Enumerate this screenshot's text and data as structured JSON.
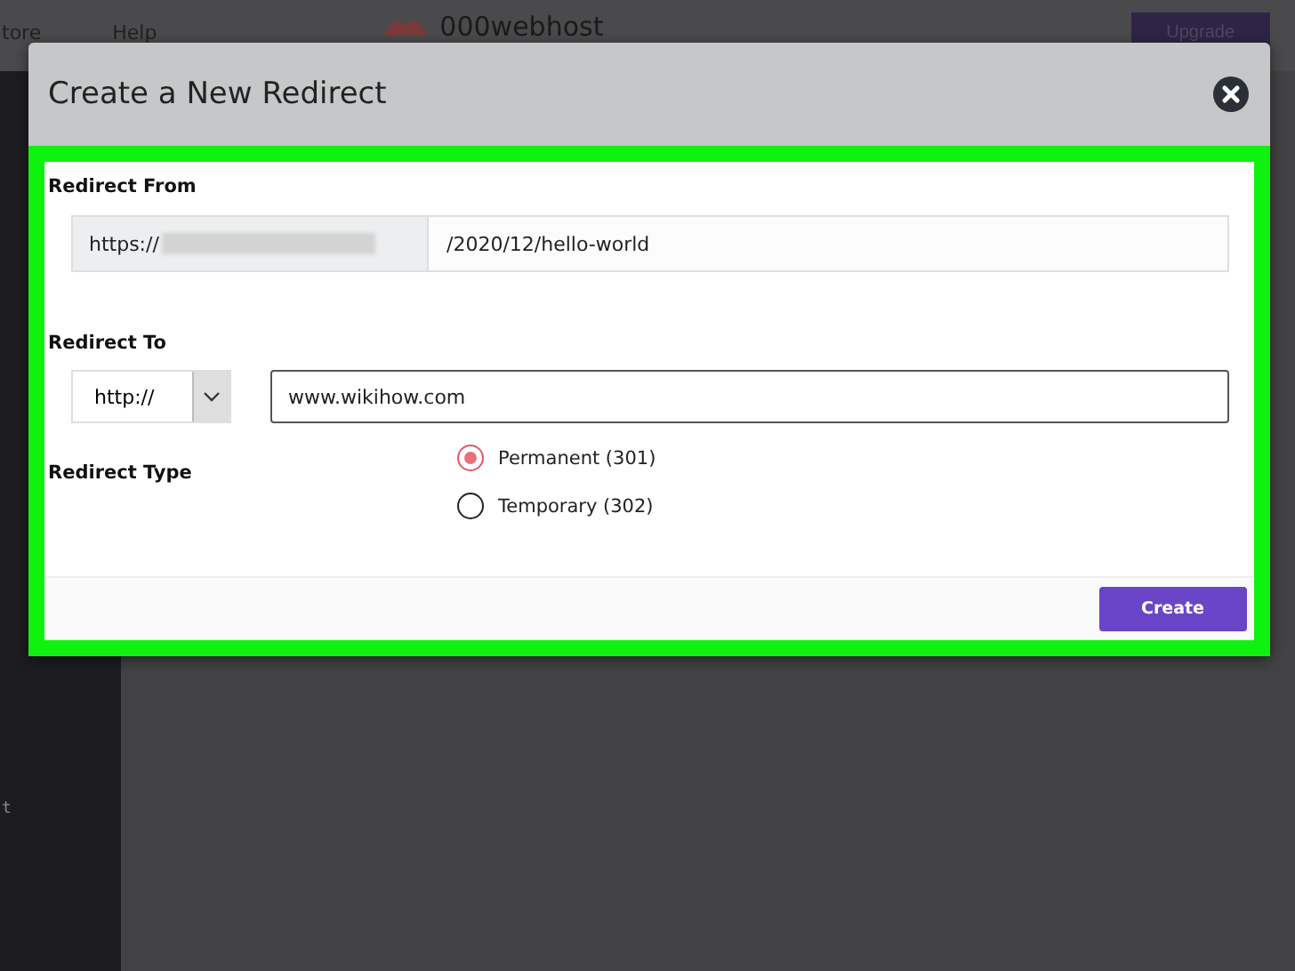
{
  "topbar": {
    "nav": [
      "tore",
      "Help"
    ],
    "logo": "000webhost",
    "upgrade": "Upgrade"
  },
  "sidebar": {
    "items": [
      "t"
    ]
  },
  "modal": {
    "title": "Create a New Redirect",
    "from": {
      "label": "Redirect From",
      "prefix": "https://",
      "path": "/2020/12/hello-world"
    },
    "to": {
      "label": "Redirect To",
      "protocol": "http://",
      "value": "www.wikihow.com"
    },
    "type": {
      "label": "Redirect Type",
      "options": [
        {
          "label": "Permanent (301)",
          "selected": true
        },
        {
          "label": "Temporary (302)",
          "selected": false
        }
      ]
    },
    "create": "Create"
  }
}
